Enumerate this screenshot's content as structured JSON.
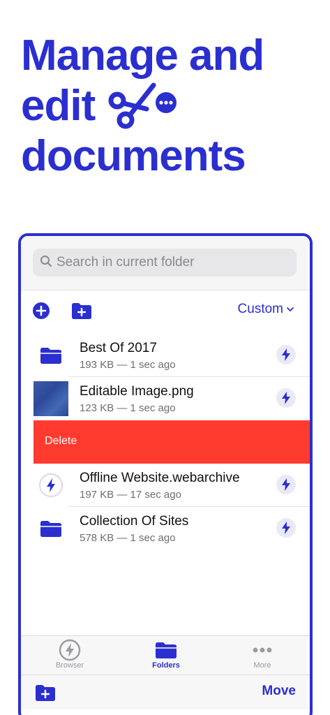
{
  "headline": {
    "line1": "Manage and",
    "line2": "edit",
    "line3": "documents"
  },
  "search": {
    "placeholder": "Search in current folder"
  },
  "toolbar": {
    "sort_label": "Custom"
  },
  "files": [
    {
      "name": "Best Of 2017",
      "meta": "193 KB — 1 sec ago",
      "icon": "folder-icon"
    },
    {
      "name": "Editable Image.png",
      "meta": "123 KB — 1 sec ago",
      "icon": "image-thumbnail"
    },
    {
      "name": "Offline Website.webarchive",
      "meta": "197 KB — 17 sec ago",
      "icon": "bolt-icon"
    },
    {
      "name": "Collection Of Sites",
      "meta": "578 KB — 1 sec ago",
      "icon": "folder-icon"
    }
  ],
  "swipe_action": {
    "label": "Delete"
  },
  "tabs": [
    {
      "label": "Browser",
      "icon": "bolt-icon"
    },
    {
      "label": "Folders",
      "icon": "folder-icon"
    },
    {
      "label": "More",
      "icon": "ellipsis-icon"
    }
  ],
  "bottombar": {
    "move_label": "Move"
  },
  "colors": {
    "accent": "#2b2fcf",
    "delete": "#ff3b30"
  }
}
